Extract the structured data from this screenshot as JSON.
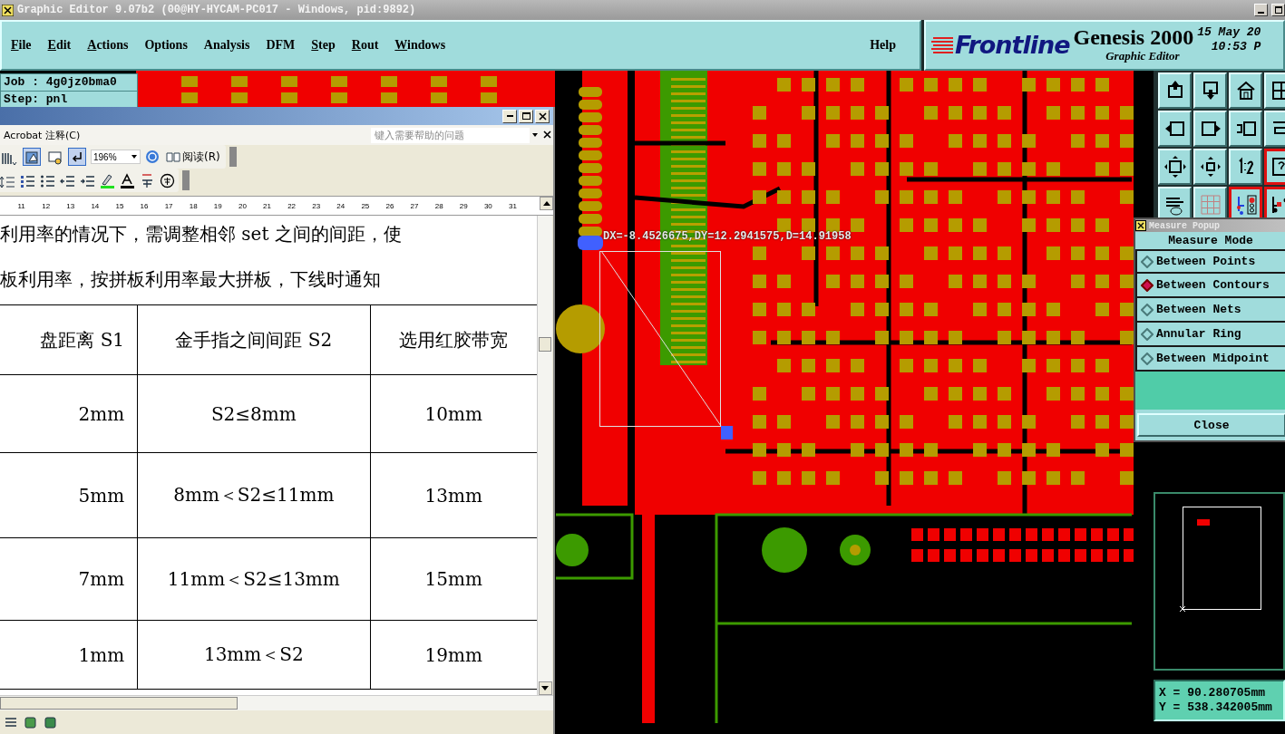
{
  "title_bar": {
    "title": "Graphic Editor 9.07b2 (00@HY-HYCAM-PC017 - Windows, pid:9892)"
  },
  "menu": [
    {
      "label": "File",
      "underlined_key": true
    },
    {
      "label": "Edit",
      "underlined_key": true
    },
    {
      "label": "Actions",
      "underlined_key": true
    },
    {
      "label": "Options",
      "underlined_key": false
    },
    {
      "label": "Analysis",
      "underlined_key": false
    },
    {
      "label": "DFM",
      "underlined_key": false
    },
    {
      "label": "Step",
      "underlined_key": true
    },
    {
      "label": "Rout",
      "underlined_key": true
    },
    {
      "label": "Windows",
      "underlined_key": true
    }
  ],
  "help_menu": "Help",
  "brand": {
    "logo": "Frontline",
    "product": "Genesis 2000",
    "subtitle": "Graphic Editor",
    "date": "15 May 20",
    "time": "10:53 P"
  },
  "job_panel": {
    "job": "Job : 4g0jz0bma0",
    "step": "Step: pnl"
  },
  "document_window": {
    "menu": "Acrobat 注释(C)",
    "help_search": {
      "placeholder": "键入需要帮助的问题"
    },
    "toolbar_1": [
      {
        "pressed": false
      },
      {
        "pressed": true
      },
      {
        "pressed": false
      },
      {
        "pressed": true
      }
    ],
    "zoom": "196%",
    "read_button": "阅读(R)",
    "ruler": [
      "11",
      "12",
      "13",
      "14",
      "15",
      "16",
      "17",
      "18",
      "19",
      "20",
      "21",
      "22",
      "23",
      "24",
      "25",
      "26",
      "27",
      "28",
      "29",
      "30",
      "31"
    ],
    "paragraphs": [
      "利用率的情况下，需调整相邻 set 之间的间距，使",
      "板利用率，按拼板利用率最大拼板，下线时通知"
    ],
    "table": {
      "header": [
        "盘距离 S1",
        "金手指之间间距 S2",
        "选用红胶带宽"
      ],
      "rows": [
        [
          "2mm",
          "S2≤8mm",
          "10mm"
        ],
        [
          "5mm",
          "8mm＜S2≤11mm",
          "13mm"
        ],
        [
          "7mm",
          "11mm＜S2≤13mm",
          "15mm"
        ],
        [
          "1mm",
          "13mm＜S2",
          "19mm"
        ]
      ]
    }
  },
  "measurement": {
    "readout": "DX=-8.4526675,DY=12.2941575,D=14.91958"
  },
  "measure_popup": {
    "title": "Measure Popup",
    "heading": "Measure Mode",
    "modes": [
      {
        "label": "Between Points",
        "selected": false
      },
      {
        "label": "Between Contours",
        "selected": true
      },
      {
        "label": "Between Nets",
        "selected": false
      },
      {
        "label": "Annular Ring",
        "selected": false
      },
      {
        "label": "Between Midpoint",
        "selected": false
      }
    ],
    "close": "Close"
  },
  "tool_buttons": [
    {
      "selected": false
    },
    {
      "selected": false
    },
    {
      "selected": false
    },
    {
      "selected": false
    },
    {
      "selected": false
    },
    {
      "selected": false
    },
    {
      "selected": false
    },
    {
      "selected": false
    },
    {
      "selected": false
    },
    {
      "selected": false
    },
    {
      "selected": false
    },
    {
      "selected": true
    },
    {
      "selected": false
    },
    {
      "selected": false
    },
    {
      "selected": true
    },
    {
      "selected": true
    }
  ],
  "coordinates": {
    "x": "X = 90.280705mm",
    "y": "Y = 538.342005mm"
  }
}
